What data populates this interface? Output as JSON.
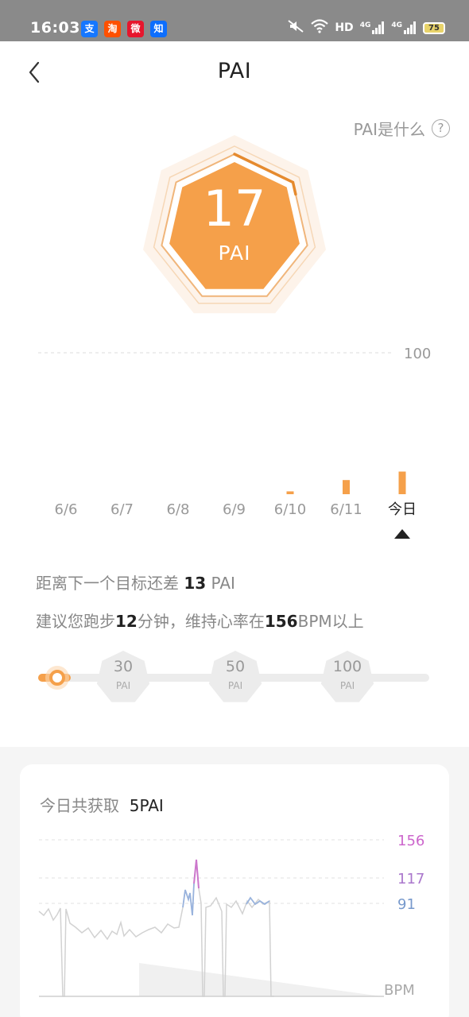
{
  "status_bar": {
    "time": "16:03",
    "apps": [
      {
        "label": "支",
        "color": "#1677ff"
      },
      {
        "label": "淘",
        "color": "#ff5000"
      },
      {
        "label": "微",
        "color": "#e6162d"
      },
      {
        "label": "知",
        "color": "#0d6efd"
      }
    ],
    "network": "HD",
    "signal1": "4G",
    "signal2": "4G",
    "battery": "75"
  },
  "header": {
    "title": "PAI"
  },
  "help": {
    "label": "PAI是什么",
    "icon_glyph": "?"
  },
  "badge": {
    "value": "17",
    "unit": "PAI",
    "progress": 0.17,
    "color": "#f5a04a"
  },
  "chart_data": {
    "type": "bar",
    "categories": [
      "6/6",
      "6/7",
      "6/8",
      "6/9",
      "6/10",
      "6/11",
      "今日"
    ],
    "values": [
      0,
      0,
      0,
      0,
      1,
      5,
      8
    ],
    "ylim": [
      0,
      50
    ],
    "reference_label": "100",
    "selected_index": 6,
    "bar_color": "#f5a04a"
  },
  "goal": {
    "prefix": "距离下一个目标还差 ",
    "value": "13",
    "suffix": " PAI"
  },
  "advice": {
    "p1": "建议您跑步",
    "minutes": "12",
    "p2": "分钟，维持心率在",
    "bpm": "156",
    "p3": "BPM以上"
  },
  "goal_track": {
    "progress": 0.17,
    "milestones": [
      {
        "value": "30",
        "unit": "PAI"
      },
      {
        "value": "50",
        "unit": "PAI"
      },
      {
        "value": "100",
        "unit": "PAI"
      }
    ]
  },
  "today_card": {
    "title": "今日共获取",
    "value": "5PAI",
    "hr_levels": [
      {
        "label": "156",
        "color": "#cc66cc"
      },
      {
        "label": "117",
        "color": "#aa77cc"
      },
      {
        "label": "91",
        "color": "#7799cc"
      }
    ],
    "unit_label": "BPM"
  }
}
